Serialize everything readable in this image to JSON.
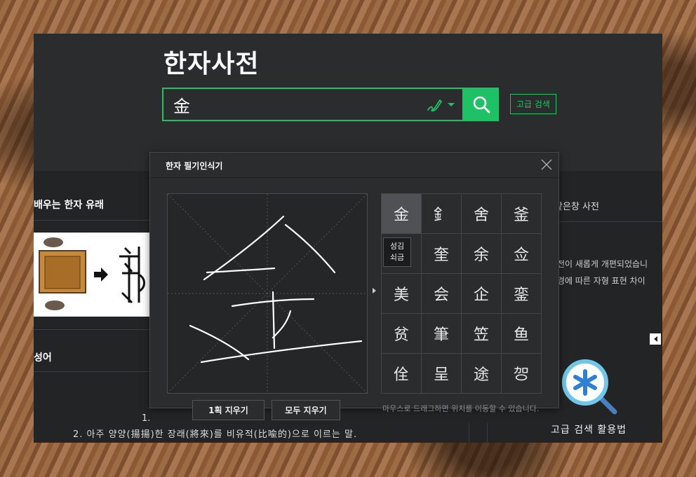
{
  "header": {
    "title": "한자사전"
  },
  "search": {
    "value": "金",
    "button_label": "검색",
    "advanced_label": "고급 검색"
  },
  "left": {
    "section1_title": "배우는 한자 유래",
    "section2_title": "성어",
    "definition1_num": "1.",
    "definition2": "2. 아주 양양(揚揚)한 장래(將來)를 비유적(比喩的)으로 이르는 말."
  },
  "right": {
    "title": "같은창 사전",
    "notice_line1": "전이 새롭게 개편되었습니",
    "notice_line2": "경에 따른 자형 표현 차이",
    "advanced_howto": "고급 검색 활용법"
  },
  "popup": {
    "title": "한자 필기인식기",
    "candidates": [
      "金",
      "釒",
      "舍",
      "釜",
      "",
      "奎",
      "余",
      "佥",
      "美",
      "会",
      "企",
      "銮",
      "贫",
      "筆",
      "笠",
      "鱼",
      "佺",
      "呈",
      "途",
      "㔔"
    ],
    "tooltip_line1": "성김",
    "tooltip_line2": "쇠금",
    "undo_stroke_label": "1획 지우기",
    "clear_all_label": "모두 지우기",
    "hint": "마우스로 드래그하면 위치를 이동할 수 있습니다."
  },
  "colors": {
    "accent": "#1fc166",
    "panel": "#2b2c2e",
    "panel_dark": "#232426"
  },
  "icons": {
    "search": "magnifier-icon",
    "handwrite": "pen-icon",
    "close": "close-icon",
    "advanced_help": "asterisk-magnifier-icon"
  }
}
